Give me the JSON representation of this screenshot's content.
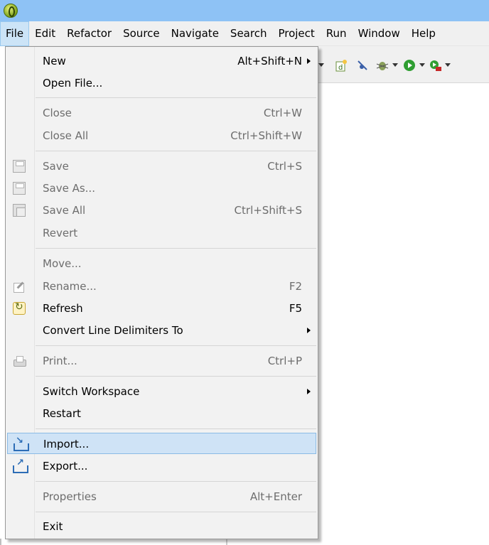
{
  "menubar": {
    "items": [
      "File",
      "Edit",
      "Refactor",
      "Source",
      "Navigate",
      "Search",
      "Project",
      "Run",
      "Window",
      "Help"
    ]
  },
  "file_menu": {
    "new": {
      "label": "New",
      "shortcut": "Alt+Shift+N"
    },
    "open_file": {
      "label": "Open File..."
    },
    "close": {
      "label": "Close",
      "shortcut": "Ctrl+W"
    },
    "close_all": {
      "label": "Close All",
      "shortcut": "Ctrl+Shift+W"
    },
    "save": {
      "label": "Save",
      "shortcut": "Ctrl+S"
    },
    "save_as": {
      "label": "Save As..."
    },
    "save_all": {
      "label": "Save All",
      "shortcut": "Ctrl+Shift+S"
    },
    "revert": {
      "label": "Revert"
    },
    "move": {
      "label": "Move..."
    },
    "rename": {
      "label": "Rename...",
      "shortcut": "F2"
    },
    "refresh": {
      "label": "Refresh",
      "shortcut": "F5"
    },
    "convert_line_delimiters": {
      "label": "Convert Line Delimiters To"
    },
    "print": {
      "label": "Print...",
      "shortcut": "Ctrl+P"
    },
    "switch_workspace": {
      "label": "Switch Workspace"
    },
    "restart": {
      "label": "Restart"
    },
    "import": {
      "label": "Import..."
    },
    "export": {
      "label": "Export..."
    },
    "properties": {
      "label": "Properties",
      "shortcut": "Alt+Enter"
    },
    "exit": {
      "label": "Exit"
    }
  },
  "icons": {
    "app": "eclipse-logo-icon",
    "save": "save-icon",
    "save_as": "save-as-icon",
    "save_all": "save-all-icon",
    "rename": "rename-icon",
    "refresh": "refresh-icon",
    "print": "print-icon",
    "import": "import-icon",
    "export": "export-icon"
  },
  "colors": {
    "titlebar": "#8ec2f5",
    "menu_active": "#cce4f7",
    "menu_hover": "#cfe3f6",
    "disabled_text": "#6d6d6d"
  }
}
